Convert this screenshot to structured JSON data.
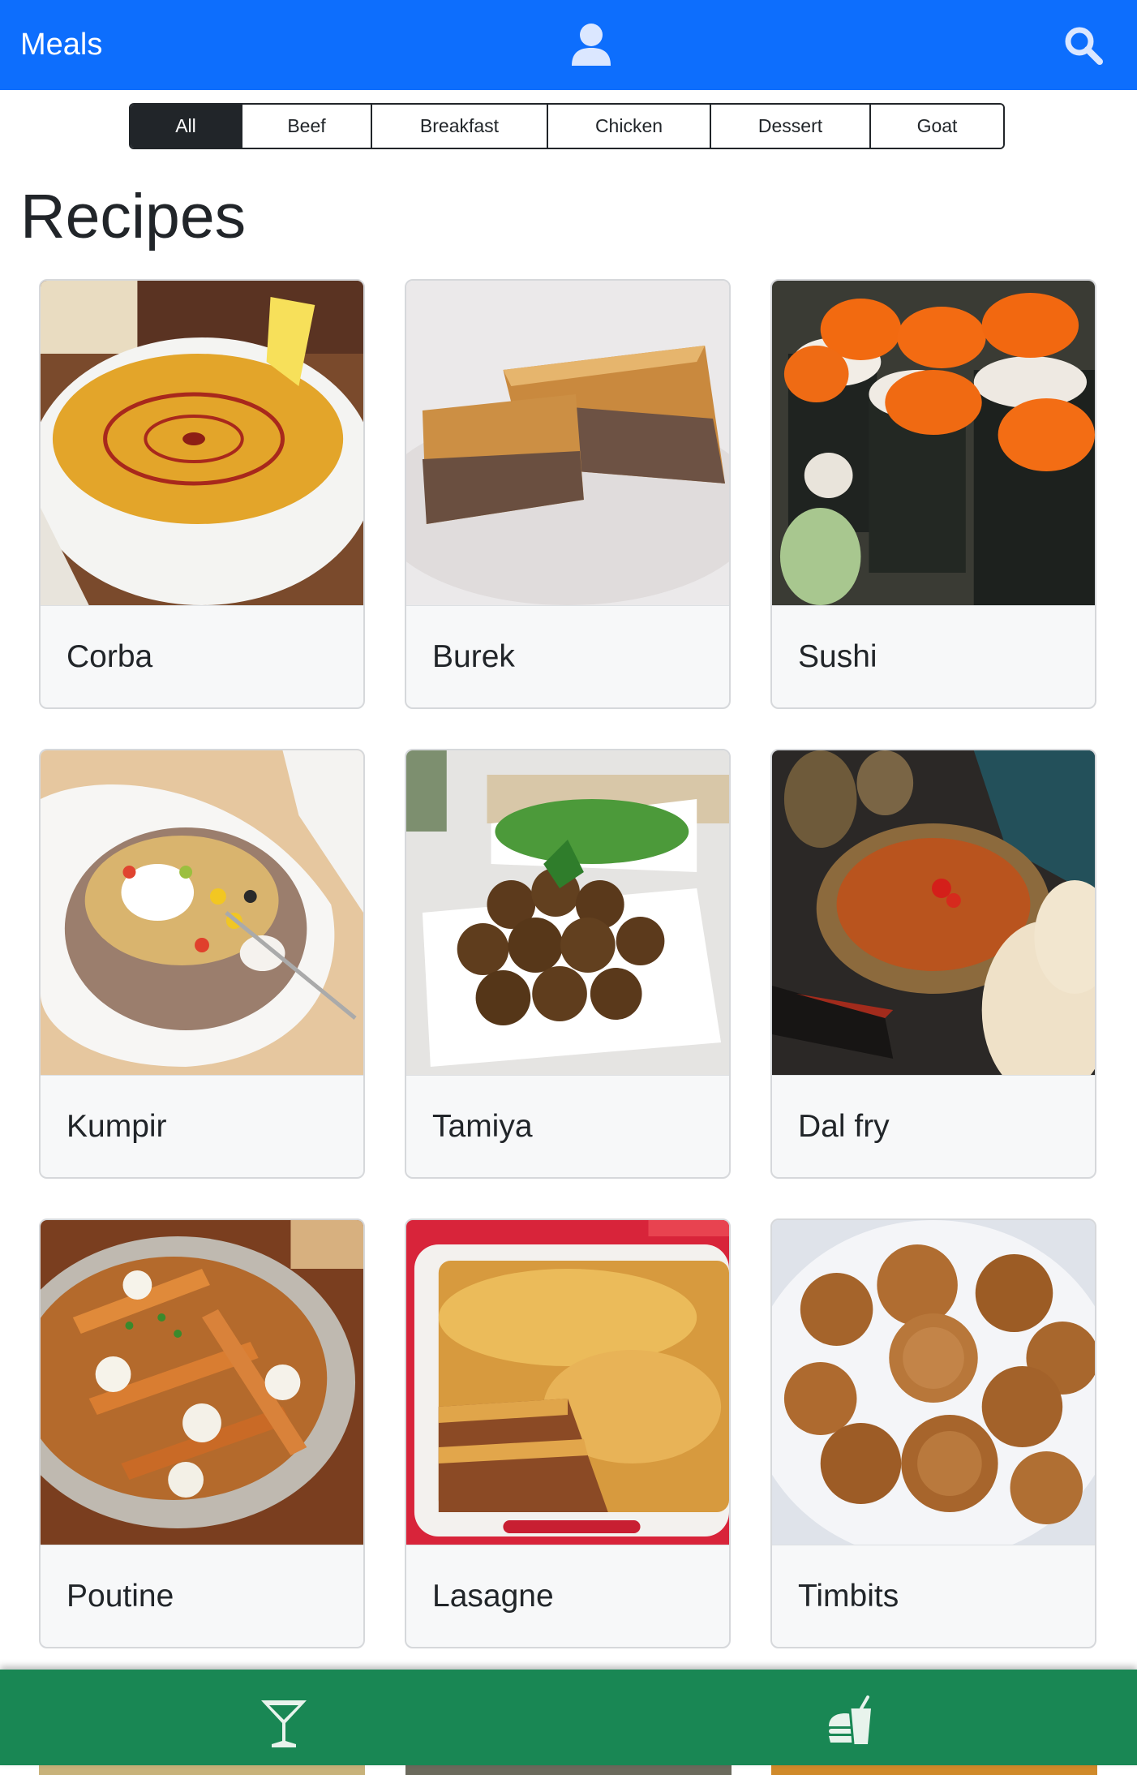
{
  "header": {
    "brand": "Meals",
    "user_icon": "user-icon",
    "search_icon": "search-icon",
    "color": "#0d6efd"
  },
  "filters": [
    {
      "label": "All",
      "active": true
    },
    {
      "label": "Beef",
      "active": false
    },
    {
      "label": "Breakfast",
      "active": false
    },
    {
      "label": "Chicken",
      "active": false
    },
    {
      "label": "Dessert",
      "active": false
    },
    {
      "label": "Goat",
      "active": false
    }
  ],
  "page_title": "Recipes",
  "recipes": [
    {
      "name": "Corba"
    },
    {
      "name": "Burek"
    },
    {
      "name": "Sushi"
    },
    {
      "name": "Kumpir"
    },
    {
      "name": "Tamiya"
    },
    {
      "name": "Dal fry"
    },
    {
      "name": "Poutine"
    },
    {
      "name": "Lasagne"
    },
    {
      "name": "Timbits"
    }
  ],
  "bottom_nav": {
    "color": "#198754",
    "items": [
      {
        "icon": "cocktail-glass-icon"
      },
      {
        "icon": "burger-drink-icon"
      }
    ]
  }
}
